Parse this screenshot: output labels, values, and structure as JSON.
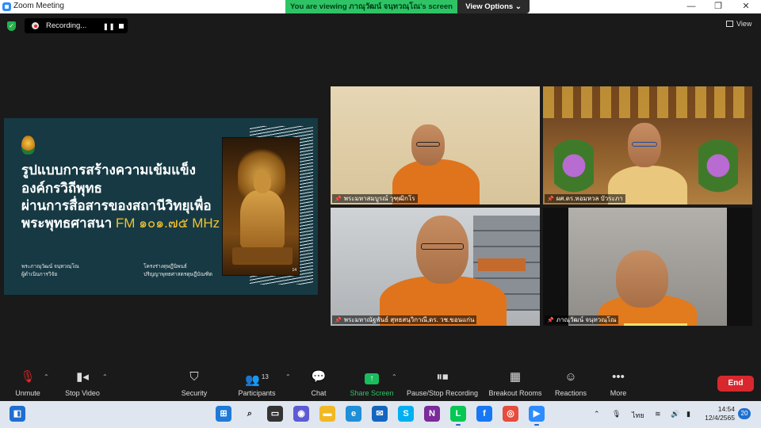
{
  "window": {
    "title": "Zoom Meeting",
    "viewing_banner": "You are viewing ภาณุวัฒน์ จนฺทวณฺโณ's screen",
    "view_options": "View Options ⌄",
    "minimize": "—",
    "maximize": "❐",
    "close": "✕"
  },
  "recording": {
    "label": "Recording...",
    "pause": "❚❚"
  },
  "view_button": "View",
  "slide": {
    "title_line1": "รูปแบบการสร้างความเข้มแข็ง",
    "title_line2": "องค์กรวิถีพุทธ",
    "title_line3": "ผ่านการสื่อสารของสถานีวิทยุเพื่อ",
    "title_line4": "พระพุทธศาสนา",
    "title_fm": "FM ๑๐๑.๗๕ MHz",
    "presenter_name": "พระภาณุวัฒน์ จนฺทวณฺโณ",
    "presenter_role": "ผู้ดำเนินการวิจัย",
    "project_name": "โครงร่างดุษฎีนิพนธ์",
    "project_degree": "ปริญญาพุทธศาสตรดุษฎีบัณฑิต",
    "slide_number": "14"
  },
  "participants": [
    {
      "label": "พระมหาสมบูรณ์ วุฑฺฒิกโร"
    },
    {
      "label": "ผศ.ดร.หอมหวล บัวระภา"
    },
    {
      "label": "พระมหาณัฐพันธ์ สุทธสนฺวิกาณี,ดร. วช.ขอนแก่น"
    },
    {
      "label": "ภาณุวัฒน์ จนฺทวณฺโณ"
    }
  ],
  "toolbar": {
    "unmute": "Unmute",
    "stop_video": "Stop Video",
    "security": "Security",
    "participants": "Participants",
    "participants_count": "13",
    "chat": "Chat",
    "share_screen": "Share Screen",
    "pause_stop_recording": "Pause/Stop Recording",
    "breakout_rooms": "Breakout Rooms",
    "reactions": "Reactions",
    "more": "More",
    "end": "End"
  },
  "taskbar": {
    "language": "ไทย",
    "time": "14:54",
    "date": "12/4/2565",
    "notifications": "20"
  },
  "colors": {
    "zoom_blue": "#2d8cff",
    "banner_green": "#2ec466",
    "end_red": "#d9272e",
    "slide_bg": "#163943",
    "slide_accent": "#f2c230",
    "robe_orange": "#e0741c"
  }
}
